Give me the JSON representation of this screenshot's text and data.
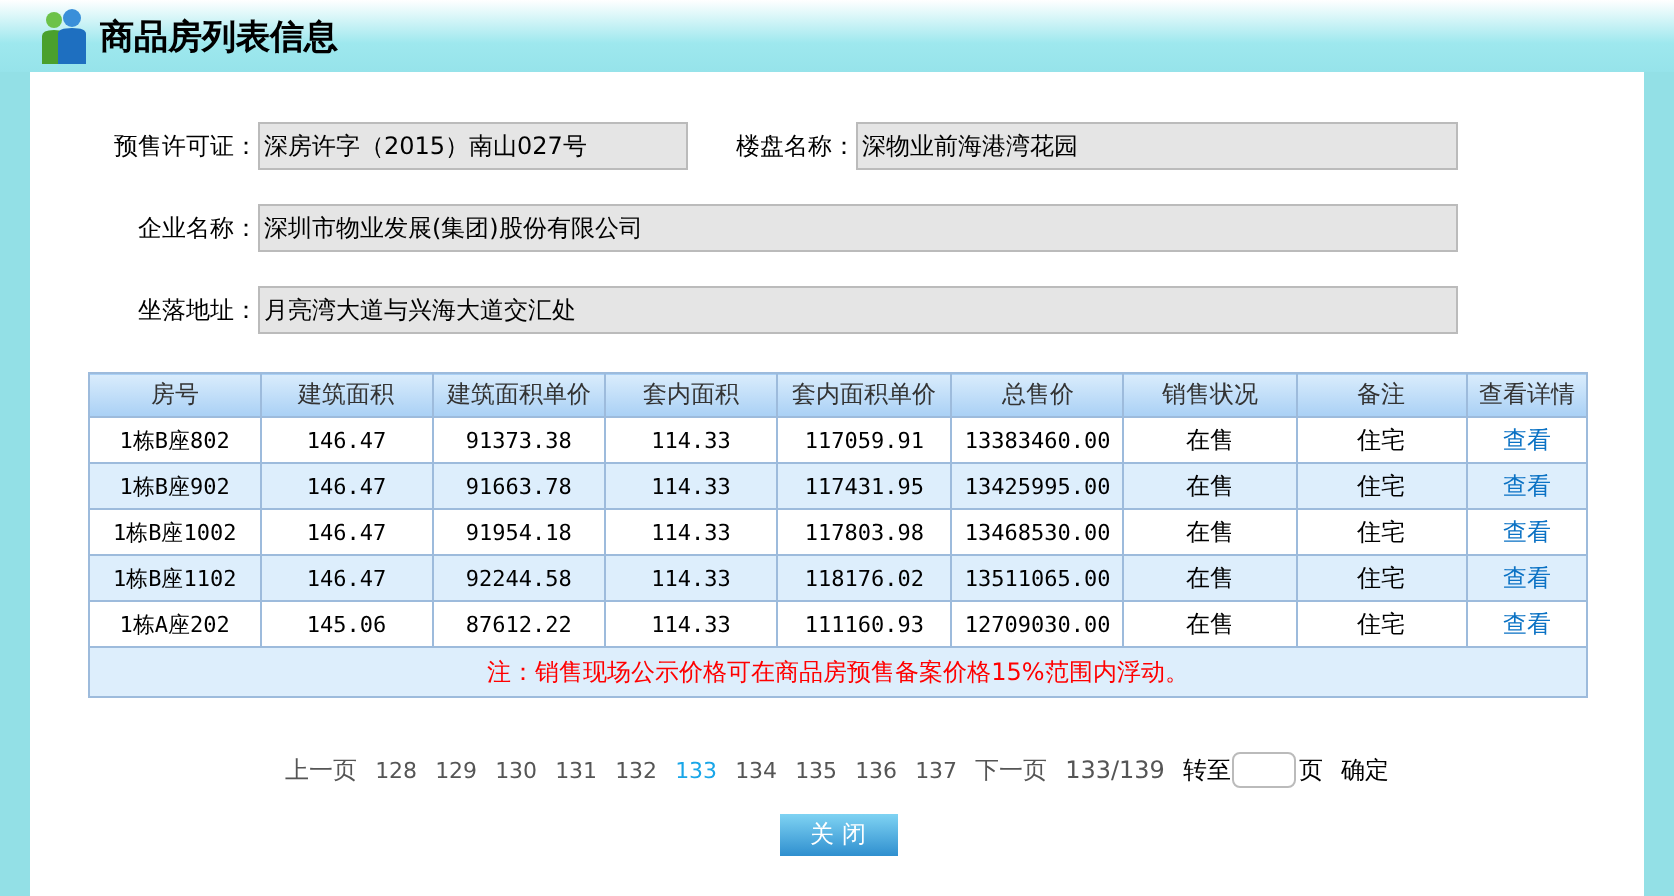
{
  "header": {
    "title": "商品房列表信息"
  },
  "fields": [
    {
      "label": "预售许可证：",
      "value": "深房许字（2015）南山027号"
    },
    {
      "label": "楼盘名称：",
      "value": "深物业前海港湾花园"
    },
    {
      "label": "企业名称：",
      "value": "深圳市物业发展(集团)股份有限公司"
    },
    {
      "label": "坐落地址：",
      "value": "月亮湾大道与兴海大道交汇处"
    }
  ],
  "table": {
    "columns": [
      "房号",
      "建筑面积",
      "建筑面积单价",
      "套内面积",
      "套内面积单价",
      "总售价",
      "销售状况",
      "备注",
      "查看详情"
    ],
    "rows": [
      [
        "1栋B座802",
        "146.47",
        "91373.38",
        "114.33",
        "117059.91",
        "13383460.00",
        "在售",
        "住宅",
        "查看"
      ],
      [
        "1栋B座902",
        "146.47",
        "91663.78",
        "114.33",
        "117431.95",
        "13425995.00",
        "在售",
        "住宅",
        "查看"
      ],
      [
        "1栋B座1002",
        "146.47",
        "91954.18",
        "114.33",
        "117803.98",
        "13468530.00",
        "在售",
        "住宅",
        "查看"
      ],
      [
        "1栋B座1102",
        "146.47",
        "92244.58",
        "114.33",
        "118176.02",
        "13511065.00",
        "在售",
        "住宅",
        "查看"
      ],
      [
        "1栋A座202",
        "145.06",
        "87612.22",
        "114.33",
        "111160.93",
        "12709030.00",
        "在售",
        "住宅",
        "查看"
      ]
    ],
    "note": "注：销售现场公示价格可在商品房预售备案价格15%范围内浮动。"
  },
  "pagination": {
    "prev": "上一页",
    "pages": [
      {
        "label": "128",
        "selected": false
      },
      {
        "label": "129",
        "selected": false
      },
      {
        "label": "130",
        "selected": false
      },
      {
        "label": "131",
        "selected": false
      },
      {
        "label": "132",
        "selected": false
      },
      {
        "label": "133",
        "selected": true
      },
      {
        "label": "134",
        "selected": false
      },
      {
        "label": "135",
        "selected": false
      },
      {
        "label": "136",
        "selected": false
      },
      {
        "label": "137",
        "selected": false
      }
    ],
    "next": "下一页",
    "count": "133/139",
    "goto": "转至",
    "page_unit": "页",
    "confirm": "确定"
  },
  "close_button": "关 闭"
}
